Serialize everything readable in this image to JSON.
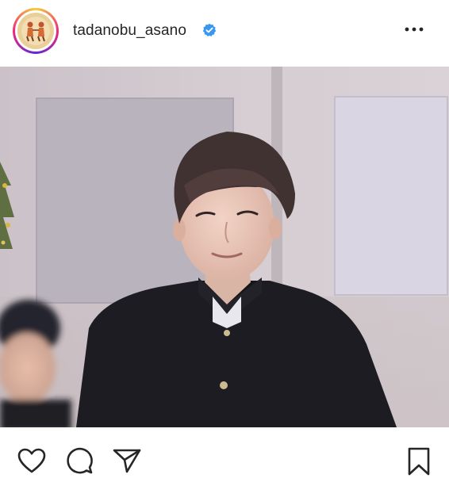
{
  "post": {
    "username": "tadanobu_asano",
    "verified": true,
    "avatar_icon": "profile-picture",
    "more_icon": "more-horizontal-icon",
    "photo_description_icon": "post-photo"
  },
  "actions": {
    "like_icon": "heart-icon",
    "comment_icon": "comment-icon",
    "share_icon": "paper-plane-icon",
    "save_icon": "bookmark-icon"
  },
  "colors": {
    "text": "#262626",
    "verified_badge": "#3897f0",
    "icon_stroke": "#262626"
  }
}
